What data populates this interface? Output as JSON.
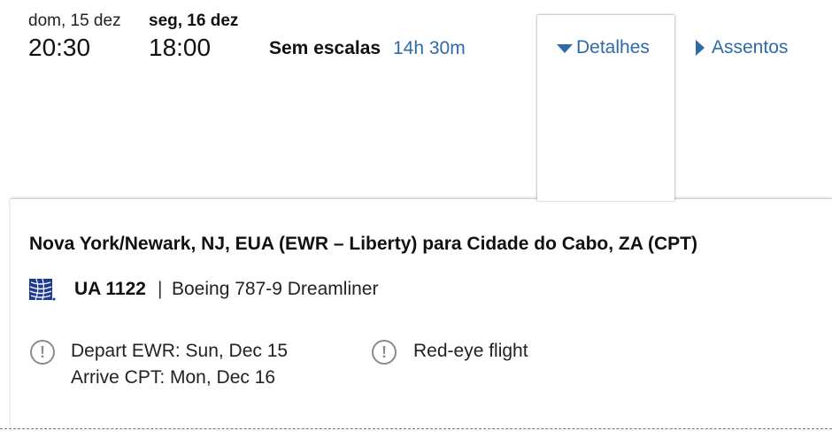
{
  "itinerary": {
    "departure": {
      "date": "dom, 15 dez",
      "time": "20:30"
    },
    "arrival": {
      "date": "seg, 16 dez",
      "time": "18:00"
    },
    "stops": "Sem escalas",
    "duration": "14h 30m"
  },
  "tabs": {
    "details_label": "Detalhes",
    "details_icon": "triangle-down-icon",
    "seats_label": "Assentos",
    "seats_icon": "triangle-right-icon"
  },
  "details": {
    "route": "Nova York/Newark, NJ, EUA (EWR – Liberty) para Cidade do Cabo, ZA (CPT)",
    "airline_logo": "united-globe-logo",
    "flight_number": "UA 1122",
    "separator": "|",
    "aircraft": "Boeing 787-9 Dreamliner",
    "alerts": [
      {
        "icon": "exclamation-circle-icon",
        "line1": "Depart EWR: Sun, Dec 15",
        "line2": "Arrive CPT: Mon, Dec 16"
      },
      {
        "icon": "exclamation-circle-icon",
        "line1": "Red-eye flight"
      }
    ],
    "alert_symbol": "!"
  },
  "colors": {
    "link": "#2f6aa8",
    "united_blue": "#1d3c8f",
    "icon_gray": "#8c8c8c"
  }
}
